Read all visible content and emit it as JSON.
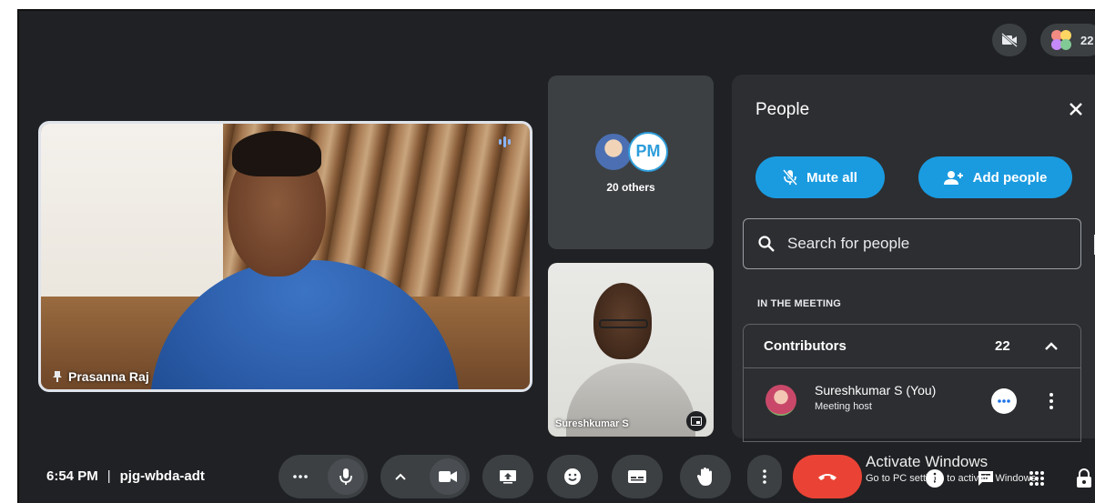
{
  "top_bar": {
    "camera_off_icon": "videocam-off-icon",
    "people_count": "22"
  },
  "tiles": {
    "main": {
      "name": "Prasanna Raj",
      "pin_icon": "pin-icon",
      "speaking_icon": "audio-level-icon"
    },
    "others": {
      "label": "20 others",
      "avatar_initials": "PM"
    },
    "self": {
      "name": "Sureshkumar S"
    }
  },
  "people_panel": {
    "title": "People",
    "mute_all_label": "Mute all",
    "add_people_label": "Add people",
    "search_placeholder": "Search for people",
    "section_heading": "IN THE MEETING",
    "group_label": "Contributors",
    "group_count": "22",
    "participants": [
      {
        "name": "Sureshkumar S (You)",
        "role": "Meeting host"
      }
    ]
  },
  "bottom_bar": {
    "time": "6:54 PM",
    "separator": "|",
    "meeting_code": "pjg-wbda-adt"
  },
  "watermark": {
    "title": "Activate Windows",
    "subtitle": "Go to PC settings to activate Windows."
  },
  "colors": {
    "background": "#202124",
    "tile": "#3c4043",
    "panel": "#2d2e31",
    "accent_blue": "#1a9be0",
    "leave_red": "#ea4335"
  }
}
